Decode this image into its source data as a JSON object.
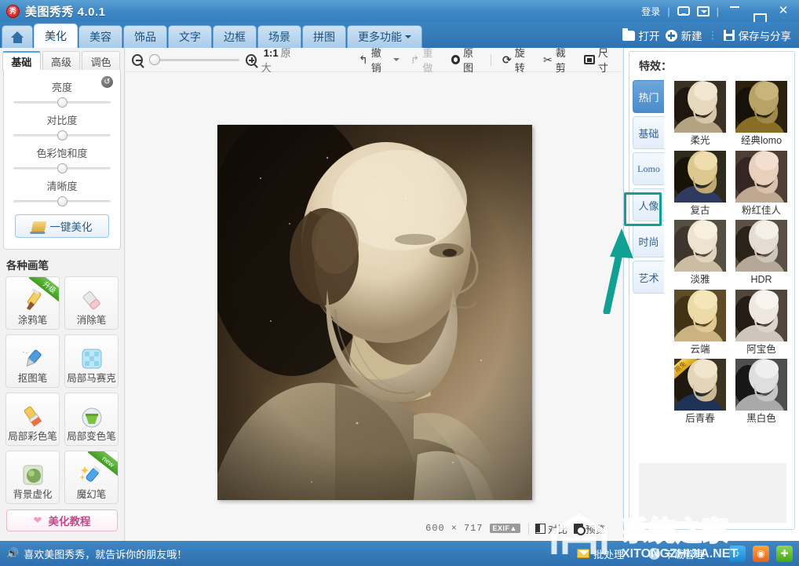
{
  "titlebar": {
    "logo_text": "秀",
    "app_title": "美图秀秀 4.0.1",
    "login_label": "登录",
    "separator": "|",
    "icons": {
      "message": "message-icon",
      "dropdown": "dropdown-icon"
    },
    "window_controls": {
      "minimize": "—",
      "maximize": "□",
      "close": "✕"
    }
  },
  "navbar": {
    "tabs": [
      {
        "label": "",
        "name": "home",
        "active": false
      },
      {
        "label": "美化",
        "name": "beautify",
        "active": true
      },
      {
        "label": "美容",
        "name": "cosmetic",
        "active": false
      },
      {
        "label": "饰品",
        "name": "decor",
        "active": false
      },
      {
        "label": "文字",
        "name": "text",
        "active": false
      },
      {
        "label": "边框",
        "name": "frame",
        "active": false
      },
      {
        "label": "场景",
        "name": "scene",
        "active": false
      },
      {
        "label": "拼图",
        "name": "collage",
        "active": false
      },
      {
        "label": "更多功能",
        "name": "more",
        "active": false
      }
    ],
    "actions": {
      "open": "打开",
      "new": "新建",
      "save_share": "保存与分享"
    }
  },
  "left_panel": {
    "subtabs": [
      {
        "label": "基础",
        "active": true
      },
      {
        "label": "高级",
        "active": false
      },
      {
        "label": "调色",
        "active": false
      }
    ],
    "reset_icon": "↺",
    "sliders": [
      {
        "label": "亮度",
        "value": 50
      },
      {
        "label": "对比度",
        "value": 50
      },
      {
        "label": "色彩饱和度",
        "value": 50
      },
      {
        "label": "清晰度",
        "value": 50
      }
    ],
    "beautify_button": "一键美化",
    "brush_section_title": "各种画笔",
    "brushes": [
      {
        "label": "涂鸦笔",
        "icon": "graffiti-pen-icon",
        "badge": "升级"
      },
      {
        "label": "消除笔",
        "icon": "eraser-pen-icon",
        "badge": ""
      },
      {
        "label": "抠图笔",
        "icon": "cutout-pen-icon",
        "badge": ""
      },
      {
        "label": "局部马赛克",
        "icon": "mosaic-icon",
        "badge": ""
      },
      {
        "label": "局部彩色笔",
        "icon": "color-brush-icon",
        "badge": ""
      },
      {
        "label": "局部变色笔",
        "icon": "paint-bucket-icon",
        "badge": ""
      },
      {
        "label": "背景虚化",
        "icon": "blur-background-icon",
        "badge": ""
      },
      {
        "label": "魔幻笔",
        "icon": "magic-pen-icon",
        "badge": "new"
      }
    ],
    "tutorial_button": "美化教程"
  },
  "toolbar": {
    "zoom_out_icon": "zoom-out-icon",
    "zoom_in_icon": "zoom-in-icon",
    "zoom_slider_value": 0,
    "ratio_label": "1:1",
    "ratio_sub": "原大",
    "undo": "撤销",
    "redo": "重做",
    "original": "原图",
    "rotate": "旋转",
    "crop": "裁剪",
    "size": "尺寸"
  },
  "canvas": {
    "image_description": "sepia vintage portrait of a bearded man",
    "width": "600",
    "sep": "×",
    "height": "717",
    "exif_badge": "EXIF▲",
    "compare": "对比",
    "preview": "预览"
  },
  "right_panel": {
    "title": "特效：",
    "categories": [
      {
        "label": "热门",
        "active": true
      },
      {
        "label": "基础",
        "active": false
      },
      {
        "label": "Lomo",
        "active": false
      },
      {
        "label": "人像",
        "active": false
      },
      {
        "label": "时尚",
        "active": false
      },
      {
        "label": "艺术",
        "active": false,
        "highlighted": true
      }
    ],
    "effects": [
      {
        "label": "柔光",
        "badge": ""
      },
      {
        "label": "经典lomo",
        "badge": ""
      },
      {
        "label": "复古",
        "badge": ""
      },
      {
        "label": "粉红佳人",
        "badge": ""
      },
      {
        "label": "淡雅",
        "badge": ""
      },
      {
        "label": "HDR",
        "badge": ""
      },
      {
        "label": "云端",
        "badge": ""
      },
      {
        "label": "阿宝色",
        "badge": ""
      },
      {
        "label": "后青春",
        "badge": "限免"
      },
      {
        "label": "黑白色",
        "badge": ""
      }
    ]
  },
  "annotation": {
    "highlight_target": "艺术",
    "arrow_color": "#13a094"
  },
  "bottombar": {
    "speaker_icon": "speaker-icon",
    "tip_text": "喜欢美图秀秀，就告诉你的朋友哦！",
    "batch": "批处理",
    "download_manager": "下载管理",
    "social_icons": [
      "share-blue-icon",
      "weibo-icon",
      "wechat-icon"
    ]
  },
  "watermark": {
    "text_cn": "系统之家",
    "text_en": "XITONGZHIJIA.NET"
  },
  "colors": {
    "brand_blue": "#3680c0",
    "accent_teal": "#13a094",
    "active_tab": "#4b8bc8",
    "pink": "#c2478c"
  }
}
